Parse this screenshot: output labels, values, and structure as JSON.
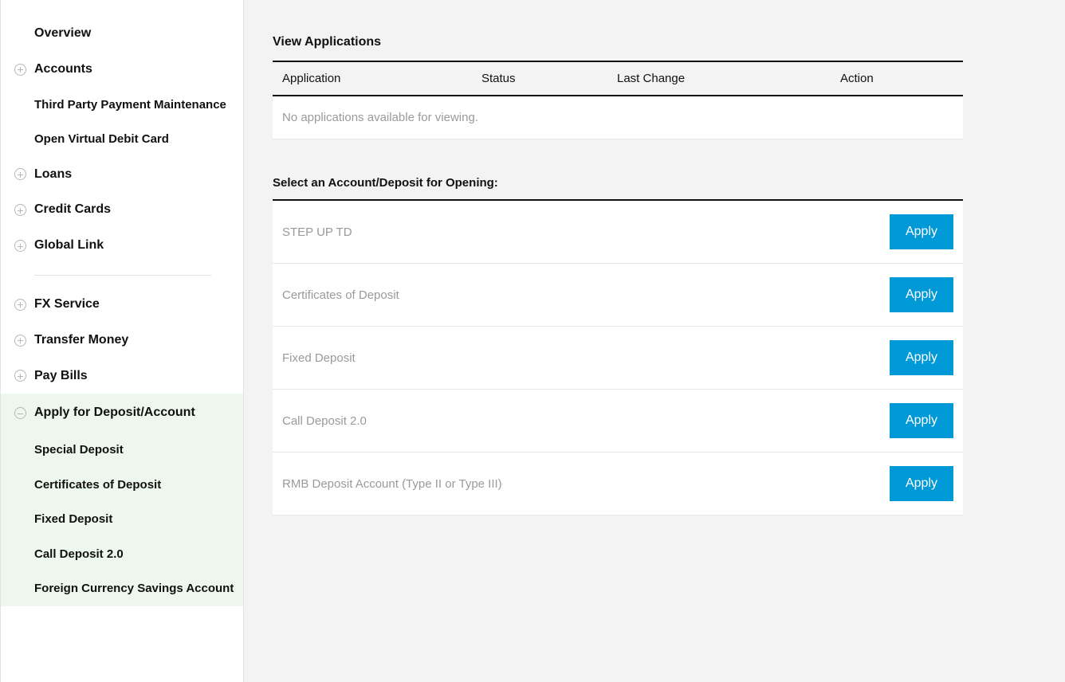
{
  "sidebar": {
    "items": [
      {
        "label": "Overview",
        "icon": null,
        "sub": false
      },
      {
        "label": "Accounts",
        "icon": "plus",
        "sub": false
      },
      {
        "label": "Third Party Payment Maintenance",
        "icon": null,
        "sub": true
      },
      {
        "label": "Open Virtual Debit Card",
        "icon": null,
        "sub": true
      },
      {
        "label": "Loans",
        "icon": "plus",
        "sub": false
      },
      {
        "label": "Credit Cards",
        "icon": "plus",
        "sub": false
      },
      {
        "label": "Global Link",
        "icon": "plus",
        "sub": false
      }
    ],
    "items2": [
      {
        "label": "FX Service",
        "icon": "plus"
      },
      {
        "label": "Transfer Money",
        "icon": "plus"
      },
      {
        "label": "Pay Bills",
        "icon": "plus"
      }
    ],
    "activeGroup": {
      "label": "Apply for Deposit/Account",
      "icon": "minus",
      "children": [
        {
          "label": "Special Deposit"
        },
        {
          "label": "Certificates of Deposit"
        },
        {
          "label": "Fixed Deposit"
        },
        {
          "label": "Call Deposit 2.0"
        },
        {
          "label": "Foreign Currency Savings Account"
        }
      ]
    }
  },
  "main": {
    "viewTitle": "View Applications",
    "columns": {
      "application": "Application",
      "status": "Status",
      "lastChange": "Last Change",
      "action": "Action"
    },
    "emptyText": "No applications available for viewing.",
    "selectTitle": "Select an Account/Deposit for Opening:",
    "options": [
      {
        "label": "STEP UP TD"
      },
      {
        "label": "Certificates of Deposit"
      },
      {
        "label": "Fixed Deposit"
      },
      {
        "label": "Call Deposit 2.0"
      },
      {
        "label": "RMB Deposit Account (Type II or Type III)"
      }
    ],
    "applyLabel": "Apply"
  }
}
